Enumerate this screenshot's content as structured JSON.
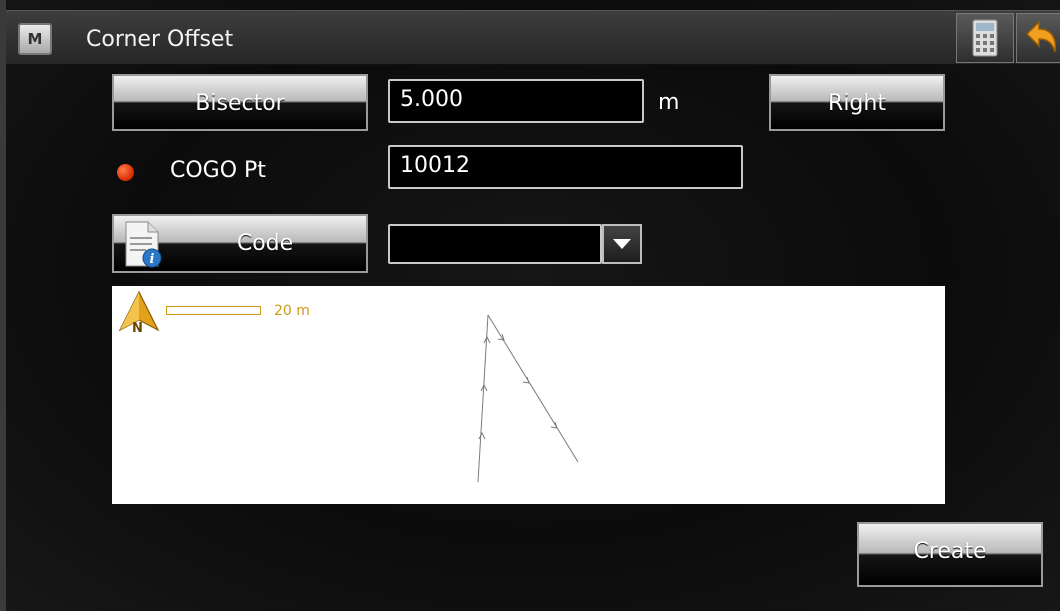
{
  "window": {
    "title": "Corner Offset",
    "menu_label": "M"
  },
  "toolbar": {
    "calculator_icon": "calculator-icon",
    "back_icon": "undo-arrow-icon"
  },
  "offset": {
    "method_button": "Bisector",
    "distance_value": "5.000",
    "unit": "m",
    "side_button": "Right"
  },
  "cogo": {
    "label": "COGO Pt",
    "status_color": "#d52a00",
    "value": "10012"
  },
  "code": {
    "button_label": "Code",
    "icon": "document-info-icon",
    "value": ""
  },
  "map": {
    "north_label": "N",
    "scale_label": "20 m"
  },
  "footer": {
    "create_button": "Create"
  },
  "colors": {
    "accent": "#d09a18",
    "background": "#0b0b0b"
  }
}
